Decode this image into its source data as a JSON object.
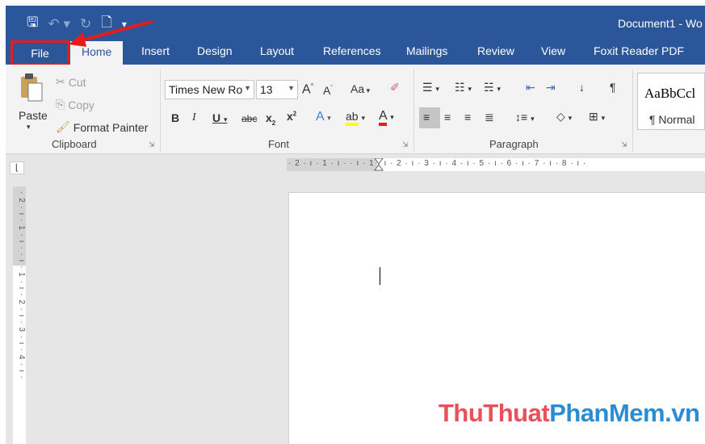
{
  "window": {
    "doc_title": "Document1 - Wo",
    "qat_icons": [
      "save-icon",
      "undo-icon",
      "redo-icon",
      "print-preview-icon",
      "customize-qat-icon"
    ]
  },
  "tabs": {
    "file": "File",
    "home": "Home",
    "insert": "Insert",
    "design": "Design",
    "layout": "Layout",
    "references": "References",
    "mailings": "Mailings",
    "review": "Review",
    "view": "View",
    "foxit": "Foxit Reader PDF"
  },
  "clipboard": {
    "paste": "Paste",
    "cut": "Cut",
    "copy": "Copy",
    "format_painter": "Format Painter",
    "label": "Clipboard"
  },
  "font": {
    "name": "Times New Ro",
    "size": "13",
    "case_label": "Aa",
    "label": "Font"
  },
  "paragraph": {
    "label": "Paragraph"
  },
  "styles": {
    "sample": "AaBbCcl",
    "name": "¶ Normal"
  },
  "rulers": {
    "horizontal": "· 2 · ı · 1 · ı ·   · ı · 1 · ı · 2 · ı · 3 · ı · 4 · ı · 5 · ı · 6 · ı · 7 · ı · 8 · ı ·",
    "vertical": "· 2 · ı · 1 · ı ·   · ı · 1 · ı · 2 · ı · 3 · ı · 4 · ı ·"
  },
  "watermark": {
    "part1": "ThuThuat",
    "part2": "PhanMem.vn"
  },
  "colors": {
    "accent": "#2b579a",
    "highlight_box": "#e81b1b",
    "watermark_red": "#e8505b",
    "watermark_blue": "#2a8dd4"
  }
}
